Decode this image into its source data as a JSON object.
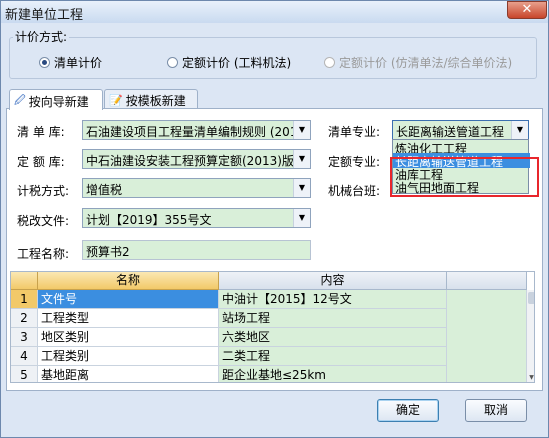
{
  "window": {
    "title": "新建单位工程",
    "close_symbol": "✕"
  },
  "pricing_mode": {
    "legend": "计价方式:",
    "options": [
      {
        "label": "清单计价",
        "checked": true,
        "disabled": false
      },
      {
        "label": "定额计价 (工料机法)",
        "checked": false,
        "disabled": false
      },
      {
        "label": "定额计价 (仿清单法/综合单价法)",
        "checked": false,
        "disabled": true
      }
    ]
  },
  "tabs": [
    {
      "label": "按向导新建",
      "icon": "wizard-icon",
      "active": true
    },
    {
      "label": "按模板新建",
      "icon": "template-icon",
      "active": false
    }
  ],
  "form": {
    "bill_lib_label": "清 单 库:",
    "bill_lib_value": "石油建设项目工程量清单编制规则 (2017",
    "quota_lib_label": "定 额 库:",
    "quota_lib_value": "中石油建设安装工程预算定额(2013)版",
    "tax_label": "计税方式:",
    "tax_value": "增值税",
    "tax_doc_label": "税改文件:",
    "tax_doc_value": "计划【2019】355号文",
    "bill_major_label": "清单专业:",
    "bill_major_value": "长距离输送管道工程",
    "quota_major_label": "定额专业:",
    "machine_label": "机械台班:",
    "project_name_label": "工程名称:",
    "project_name_value": "预算书2"
  },
  "dropdown": {
    "items": [
      {
        "label": "炼油化工工程",
        "selected": false
      },
      {
        "label": "长距离输送管道工程",
        "selected": true
      },
      {
        "label": "油库工程",
        "selected": false
      },
      {
        "label": "油气田地面工程",
        "selected": false
      }
    ]
  },
  "grid": {
    "headers": [
      "名称",
      "内容"
    ],
    "rows": [
      {
        "num": "1",
        "name": "文件号",
        "value": "中油计【2015】12号文"
      },
      {
        "num": "2",
        "name": "工程类型",
        "value": "站场工程"
      },
      {
        "num": "3",
        "name": "地区类别",
        "value": "六类地区"
      },
      {
        "num": "4",
        "name": "工程类别",
        "value": "二类工程"
      },
      {
        "num": "5",
        "name": "基地距离",
        "value": "距企业基地≤25km"
      }
    ]
  },
  "buttons": {
    "ok": "确定",
    "cancel": "取消"
  },
  "colors": {
    "field_bg": "#d9efd9",
    "highlight": "#e8262c",
    "selection": "#3b8ee0"
  }
}
